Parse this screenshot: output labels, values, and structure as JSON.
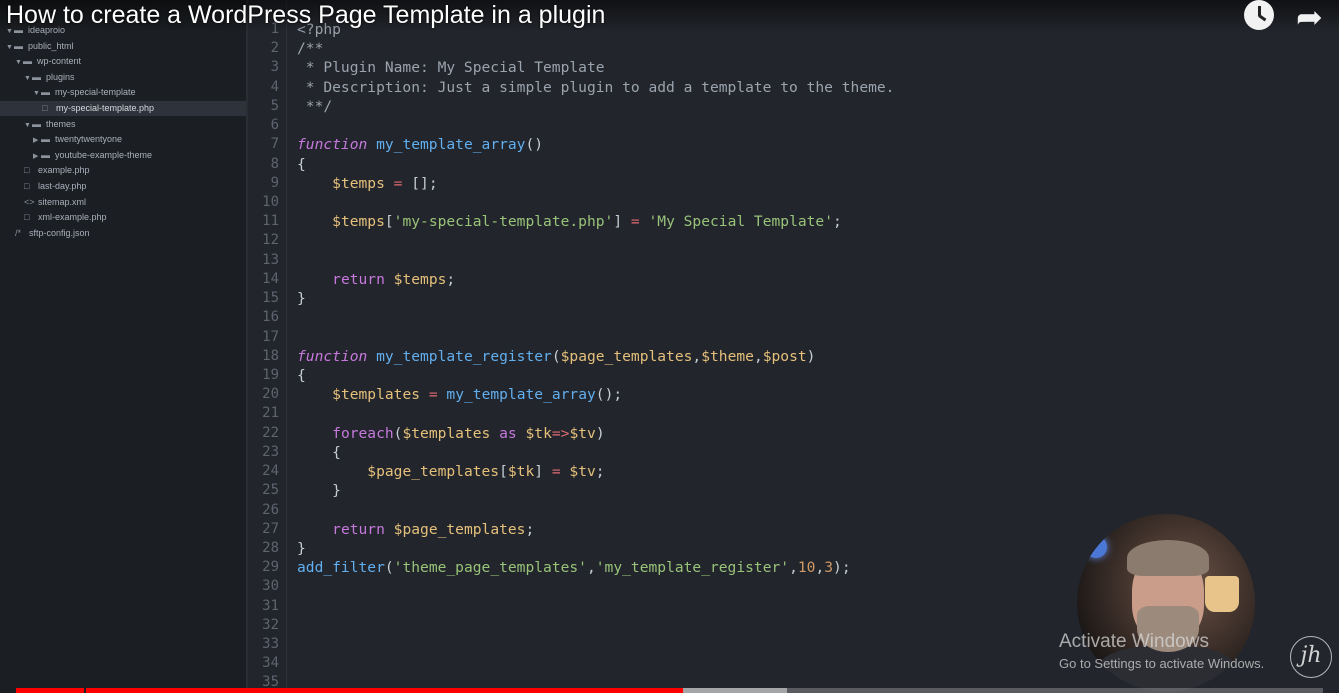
{
  "video": {
    "title": "How to create a WordPress Page Template in a plugin",
    "played_fraction": 0.51,
    "buffered_fraction": 0.59
  },
  "file_tree": [
    {
      "label": "ideaproio",
      "kind": "folder",
      "open": true,
      "depth": 0
    },
    {
      "label": "public_html",
      "kind": "folder",
      "open": true,
      "depth": 0
    },
    {
      "label": "wp-content",
      "kind": "folder",
      "open": true,
      "depth": 1
    },
    {
      "label": "plugins",
      "kind": "folder",
      "open": true,
      "depth": 2
    },
    {
      "label": "my-special-template",
      "kind": "folder",
      "open": true,
      "depth": 3
    },
    {
      "label": "my-special-template.php",
      "kind": "file",
      "depth": 4,
      "selected": true
    },
    {
      "label": "themes",
      "kind": "folder",
      "open": true,
      "depth": 2
    },
    {
      "label": "twentytwentyone",
      "kind": "folder",
      "open": false,
      "depth": 3
    },
    {
      "label": "youtube-example-theme",
      "kind": "folder",
      "open": false,
      "depth": 3
    },
    {
      "label": "example.php",
      "kind": "file",
      "depth": 2
    },
    {
      "label": "last-day.php",
      "kind": "file",
      "depth": 2
    },
    {
      "label": "sitemap.xml",
      "kind": "xml",
      "depth": 2
    },
    {
      "label": "xml-example.php",
      "kind": "file",
      "depth": 2
    },
    {
      "label": "sftp-config.json",
      "kind": "json",
      "depth": 1
    }
  ],
  "code_lines": [
    "<?php",
    "/**",
    " * Plugin Name: My Special Template",
    " * Description: Just a simple plugin to add a template to the theme.",
    " **/",
    "",
    "function my_template_array()",
    "{",
    "    $temps = [];",
    "",
    "    $temps['my-special-template.php'] = 'My Special Template';",
    "",
    "",
    "    return $temps;",
    "}",
    "",
    "",
    "function my_template_register($page_templates,$theme,$post)",
    "{",
    "    $templates = my_template_array();",
    "",
    "    foreach($templates as $tk=>$tv)",
    "    {",
    "        $page_templates[$tk] = $tv;",
    "    }",
    "",
    "    return $page_templates;",
    "}",
    "add_filter('theme_page_templates','my_template_register',10,3);",
    "",
    "",
    "",
    "",
    "",
    ""
  ],
  "watermark": {
    "title": "Activate Windows",
    "subtitle": "Go to Settings to activate Windows.",
    "logo_text": "jh"
  },
  "icons": {
    "watch_later": "clock-icon",
    "share": "share-arrow-icon"
  },
  "colors": {
    "progress_played": "#ff0000",
    "editor_bg": "#22252b",
    "sidebar_bg": "#1b1e22"
  }
}
